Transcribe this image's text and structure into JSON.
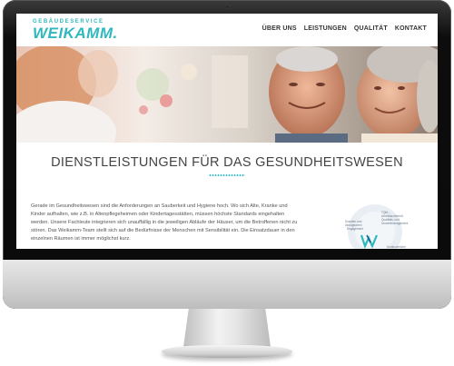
{
  "site": {
    "logo_small": "GEBÄUDESERVICE",
    "logo_main": "WEIKAMM.",
    "nav": [
      "ÜBER UNS",
      "LEISTUNGEN",
      "QUALITÄT",
      "KONTAKT"
    ]
  },
  "main": {
    "title": "DIENSTLEISTUNGEN FÜR DAS GESUNDHEITSWESEN",
    "body": "Gerade im Gesundheitswesen sind die Anforderungen an Sauberkeit und Hygiene hoch. Wo sich Alte, Kranke und Kinder aufhalten, wie z.B. in Altenpflegeheimen oder Kindertagesstätten, müssen höchste Standards eingehalten werden. Unsere Fachleute integrieren sich unauffällig in die jeweiligen Abläufe der Häuser, um die Betroffenen nicht zu stören. Das Weikamm-Team stellt sich auf die Bedürfnisse der Menschen mit Sensibilität ein. Die Einsatzdauer in den einzelnen Räumen ist immer möglichst kurz.",
    "badge_lines": [
      "TQM –",
      "Arbeitssicherheit,",
      "Qualitäts- und",
      "Umweltmanagement",
      "Sozialen und",
      "ökologischen",
      "Engagement",
      "Kontinuierliche"
    ]
  },
  "colors": {
    "brand": "#2fb8bf",
    "text": "#444444"
  }
}
